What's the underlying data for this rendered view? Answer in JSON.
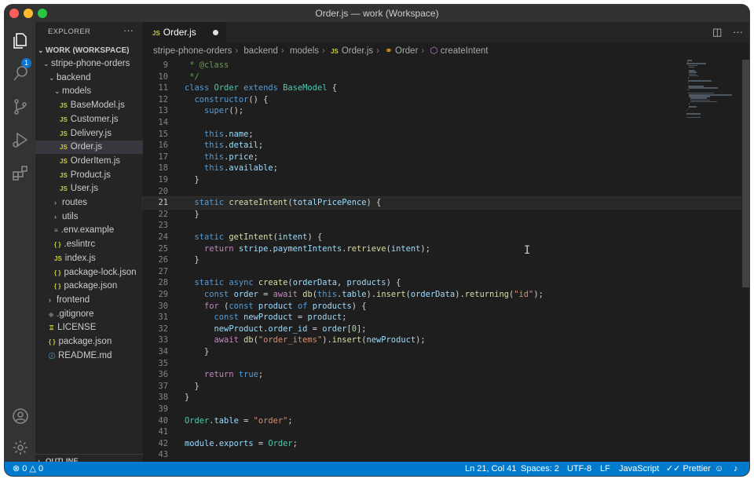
{
  "window": {
    "title": "Order.js — work (Workspace)"
  },
  "activity_bar": {
    "explorer_badge": "1"
  },
  "explorer": {
    "header": "EXPLORER",
    "more": "···",
    "workspace": "WORK (WORKSPACE)",
    "outline": "OUTLINE",
    "tree": [
      {
        "label": "stripe-phone-orders",
        "kind": "folder-open",
        "depth": 1
      },
      {
        "label": "backend",
        "kind": "folder-open",
        "depth": 2
      },
      {
        "label": "models",
        "kind": "folder-open",
        "depth": 3
      },
      {
        "label": "BaseModel.js",
        "kind": "js",
        "depth": 4
      },
      {
        "label": "Customer.js",
        "kind": "js",
        "depth": 4
      },
      {
        "label": "Delivery.js",
        "kind": "js",
        "depth": 4
      },
      {
        "label": "Order.js",
        "kind": "js",
        "depth": 4,
        "active": true
      },
      {
        "label": "OrderItem.js",
        "kind": "js",
        "depth": 4
      },
      {
        "label": "Product.js",
        "kind": "js",
        "depth": 4
      },
      {
        "label": "User.js",
        "kind": "js",
        "depth": 4
      },
      {
        "label": "routes",
        "kind": "folder",
        "depth": 3
      },
      {
        "label": "utils",
        "kind": "folder",
        "depth": 3
      },
      {
        "label": ".env.example",
        "kind": "env",
        "depth": 3
      },
      {
        "label": ".eslintrc",
        "kind": "json",
        "depth": 3
      },
      {
        "label": "index.js",
        "kind": "js",
        "depth": 3
      },
      {
        "label": "package-lock.json",
        "kind": "json",
        "depth": 3
      },
      {
        "label": "package.json",
        "kind": "json",
        "depth": 3
      },
      {
        "label": "frontend",
        "kind": "folder",
        "depth": 2
      },
      {
        "label": ".gitignore",
        "kind": "git",
        "depth": 2
      },
      {
        "label": "LICENSE",
        "kind": "license",
        "depth": 2
      },
      {
        "label": "package.json",
        "kind": "json",
        "depth": 2
      },
      {
        "label": "README.md",
        "kind": "md",
        "depth": 2
      }
    ]
  },
  "editor": {
    "tab": {
      "label": "Order.js",
      "icon": "JS"
    },
    "breadcrumb": [
      "stripe-phone-orders",
      "backend",
      "models",
      "Order.js",
      "Order",
      "createIntent"
    ],
    "current_line": 21,
    "lines": [
      {
        "n": "9",
        "html": "<span class='com'> * @class</span>"
      },
      {
        "n": "10",
        "html": "<span class='com'> */</span>"
      },
      {
        "n": "11",
        "html": "<span class='kw'>class</span> <span class='cls'>Order</span> <span class='kw'>extends</span> <span class='cls'>BaseModel</span> {"
      },
      {
        "n": "12",
        "html": "  <span class='kw'>constructor</span>() {"
      },
      {
        "n": "13",
        "html": "    <span class='kw'>super</span>();"
      },
      {
        "n": "14",
        "html": ""
      },
      {
        "n": "15",
        "html": "    <span class='kw'>this</span>.<span class='var'>name</span>;"
      },
      {
        "n": "16",
        "html": "    <span class='kw'>this</span>.<span class='var'>detail</span>;"
      },
      {
        "n": "17",
        "html": "    <span class='kw'>this</span>.<span class='var'>price</span>;"
      },
      {
        "n": "18",
        "html": "    <span class='kw'>this</span>.<span class='var'>available</span>;"
      },
      {
        "n": "19",
        "html": "  }"
      },
      {
        "n": "20",
        "html": ""
      },
      {
        "n": "21",
        "html": "  <span class='kw'>static</span> <span class='fn'>createIntent</span>(<span class='var'>totalPricePence</span>) {"
      },
      {
        "n": "22",
        "html": "  }"
      },
      {
        "n": "23",
        "html": ""
      },
      {
        "n": "24",
        "html": "  <span class='kw'>static</span> <span class='fn'>getIntent</span>(<span class='var'>intent</span>) {"
      },
      {
        "n": "25",
        "html": "    <span class='ctl'>return</span> <span class='var'>stripe</span>.<span class='var'>paymentIntents</span>.<span class='fn'>retrieve</span>(<span class='var'>intent</span>);"
      },
      {
        "n": "26",
        "html": "  }"
      },
      {
        "n": "27",
        "html": ""
      },
      {
        "n": "28",
        "html": "  <span class='kw'>static</span> <span class='kw'>async</span> <span class='fn'>create</span>(<span class='var'>orderData</span>, <span class='var'>products</span>) {"
      },
      {
        "n": "29",
        "html": "    <span class='kw'>const</span> <span class='var'>order</span> = <span class='ctl'>await</span> <span class='fn'>db</span>(<span class='kw'>this</span>.<span class='var'>table</span>).<span class='fn'>insert</span>(<span class='var'>orderData</span>).<span class='fn'>returning</span>(<span class='str'>\"id\"</span>);"
      },
      {
        "n": "30",
        "html": "    <span class='ctl'>for</span> (<span class='kw'>const</span> <span class='var'>product</span> <span class='kw'>of</span> <span class='var'>products</span>) {"
      },
      {
        "n": "31",
        "html": "      <span class='kw'>const</span> <span class='var'>newProduct</span> = <span class='var'>product</span>;"
      },
      {
        "n": "32",
        "html": "      <span class='var'>newProduct</span>.<span class='var'>order_id</span> = <span class='var'>order</span>[<span class='num'>0</span>];"
      },
      {
        "n": "33",
        "html": "      <span class='ctl'>await</span> <span class='fn'>db</span>(<span class='str'>\"order_items\"</span>).<span class='fn'>insert</span>(<span class='var'>newProduct</span>);"
      },
      {
        "n": "34",
        "html": "    }"
      },
      {
        "n": "35",
        "html": ""
      },
      {
        "n": "36",
        "html": "    <span class='ctl'>return</span> <span class='kw'>true</span>;"
      },
      {
        "n": "37",
        "html": "  }"
      },
      {
        "n": "38",
        "html": "}"
      },
      {
        "n": "39",
        "html": ""
      },
      {
        "n": "40",
        "html": "<span class='cls'>Order</span>.<span class='var'>table</span> = <span class='str'>\"order\"</span>;"
      },
      {
        "n": "41",
        "html": ""
      },
      {
        "n": "42",
        "html": "<span class='var'>module</span>.<span class='var'>exports</span> = <span class='cls'>Order</span>;"
      },
      {
        "n": "43",
        "html": ""
      }
    ]
  },
  "status_bar": {
    "errors": "0",
    "warnings": "0",
    "position": "Ln 21, Col 41",
    "spaces": "Spaces: 2",
    "encoding": "UTF-8",
    "eol": "LF",
    "language": "JavaScript",
    "formatter": "Prettier"
  },
  "colors": {
    "status_bar": "#007acc",
    "activity_bar": "#333333",
    "sidebar": "#252526",
    "editor": "#1e1e1e"
  }
}
